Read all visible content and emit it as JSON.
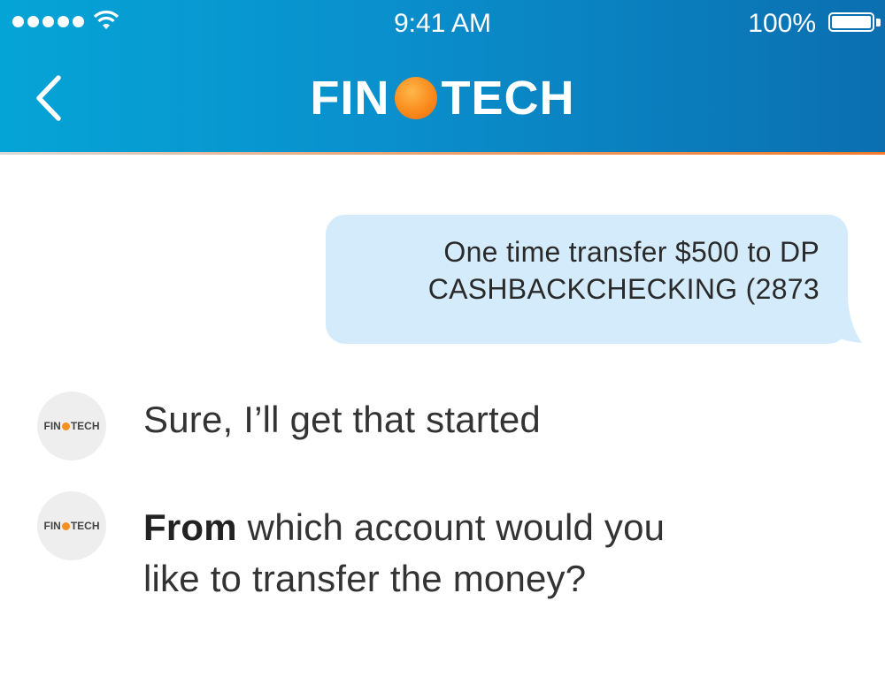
{
  "status_bar": {
    "time": "9:41 AM",
    "battery": "100%",
    "signal_icon": "signal-dots",
    "wifi_icon": "wifi-icon"
  },
  "header": {
    "back_icon": "chevron-left-icon",
    "logo_left": "FIN",
    "logo_right": "TECH",
    "colors": {
      "gradient_start": "#05a4d6",
      "gradient_end": "#0b6fb0",
      "brand_orange": "#f7901e"
    }
  },
  "messages": {
    "user": {
      "line1": "One time transfer $500 to DP",
      "line2": "CASHBACKCHECKING (2873",
      "bubble_color": "#d4ebfb"
    },
    "bot": [
      {
        "avatar_left": "FIN",
        "avatar_right": "TECH",
        "text": "Sure, I’ll get that started"
      },
      {
        "avatar_left": "FIN",
        "avatar_right": "TECH",
        "bold": "From",
        "text_rest": " which account would you",
        "line2": "like to transfer the money?"
      }
    ]
  }
}
